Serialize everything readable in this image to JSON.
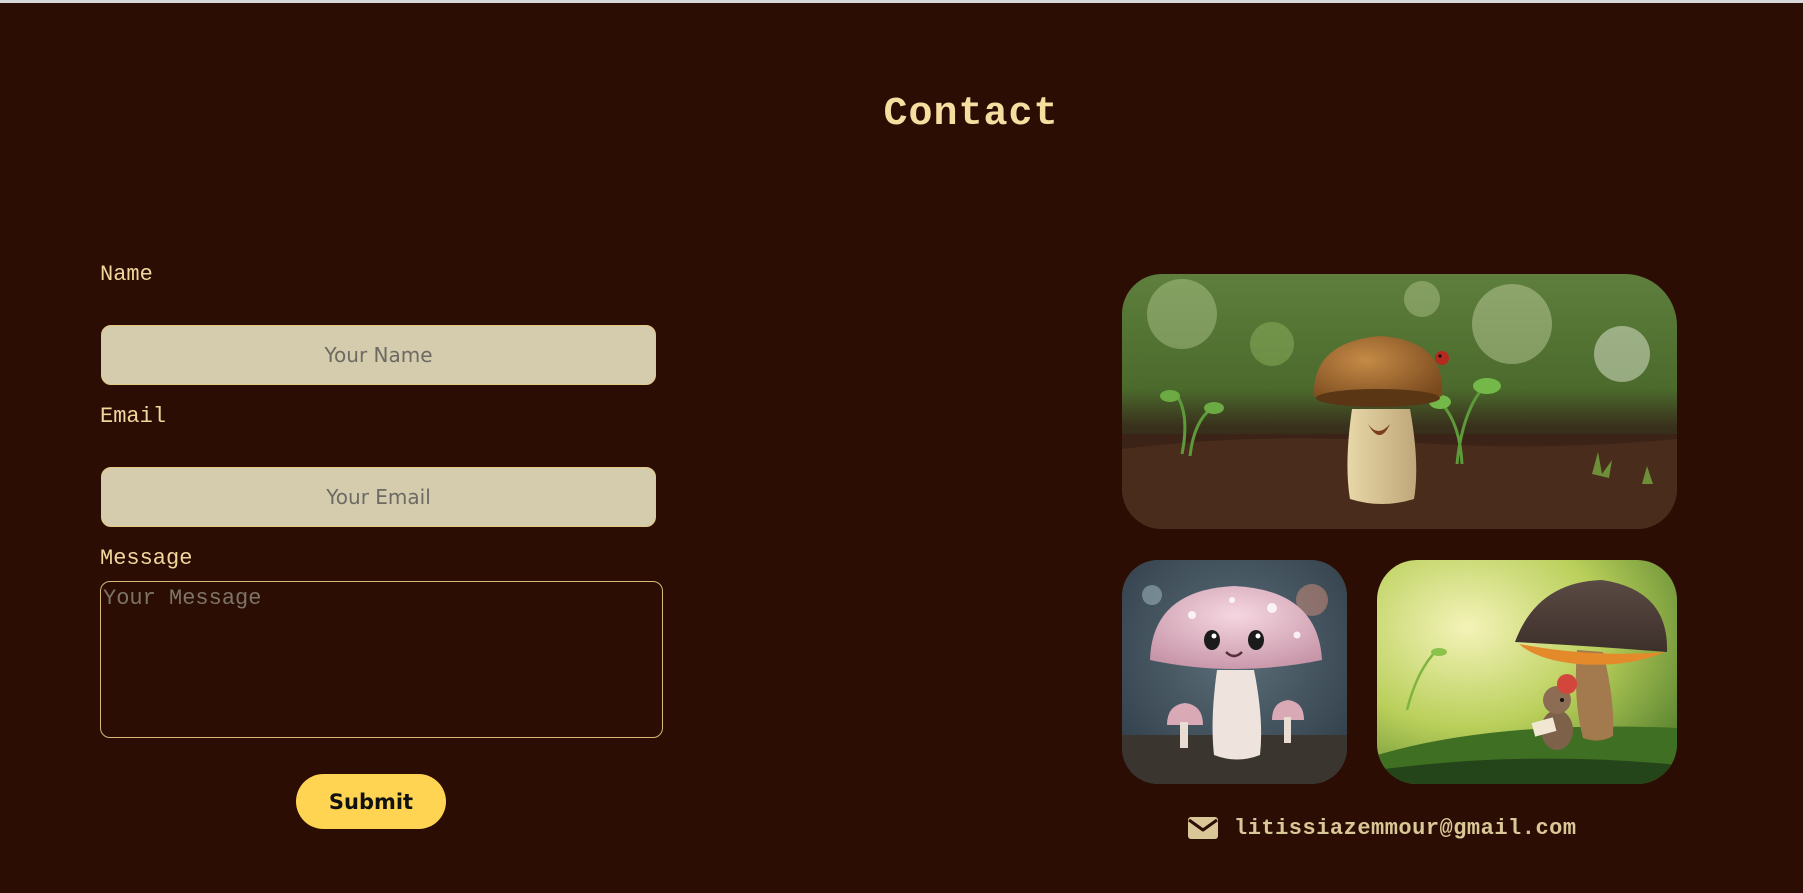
{
  "page": {
    "title": "Contact"
  },
  "form": {
    "name_label": "Name",
    "name_placeholder": "Your Name",
    "name_value": "",
    "email_label": "Email",
    "email_placeholder": "Your Email",
    "email_value": "",
    "message_label": "Message",
    "message_placeholder": "Your Message",
    "message_value": "",
    "submit_label": "Submit"
  },
  "gallery": {
    "images": [
      {
        "icon": "mushroom-on-forest-floor-photo"
      },
      {
        "icon": "cute-pink-mushroom-photo"
      },
      {
        "icon": "mouse-reading-under-mushroom-photo"
      }
    ]
  },
  "contact": {
    "icon": "envelope-icon",
    "email": "litissiazemmour@gmail.com"
  },
  "colors": {
    "background": "#2c0d04",
    "accent_text": "#f6dea1",
    "input_fill": "#d5ccad",
    "button_fill": "#ffd452"
  }
}
